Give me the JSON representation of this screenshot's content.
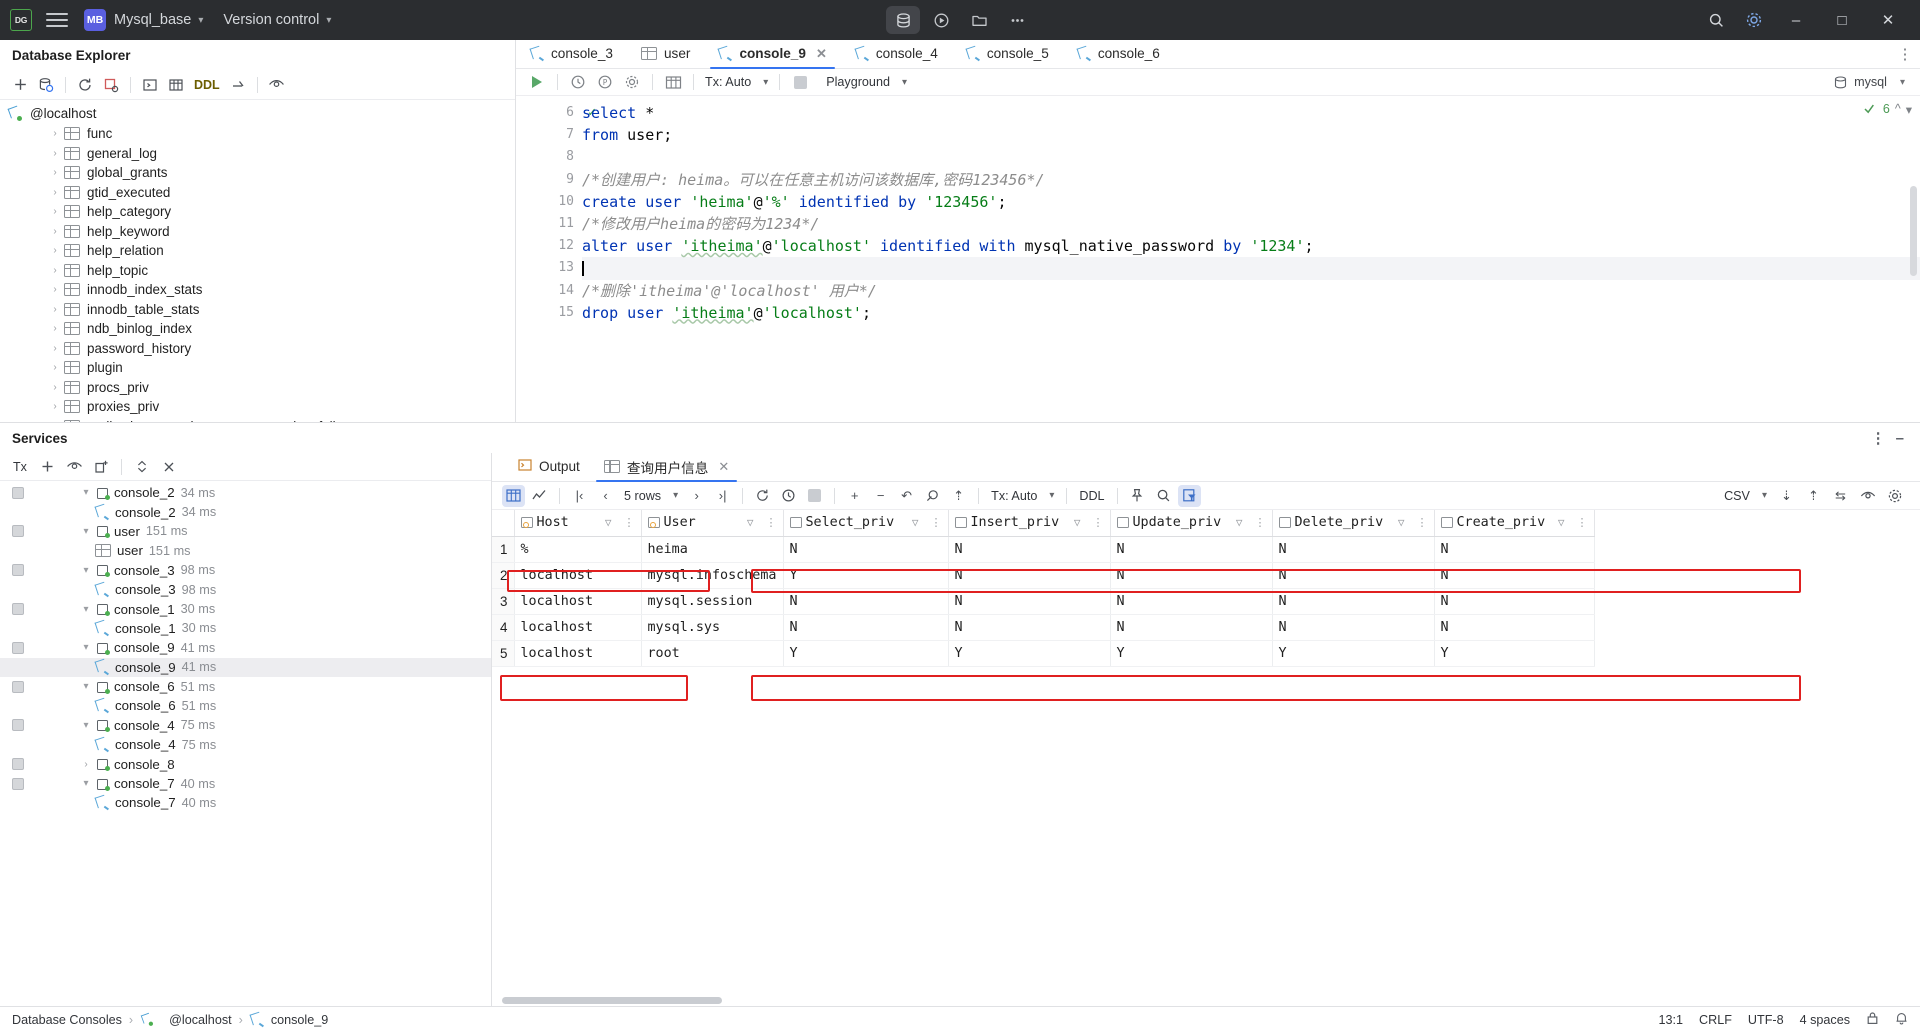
{
  "titlebar": {
    "logo": "DG",
    "project_badge": "MB",
    "project_name": "Mysql_base",
    "version_control": "Version control",
    "center_buttons": [
      "database-icon",
      "run-config-icon",
      "folder-icon",
      "more-icon"
    ],
    "right_buttons": [
      "search-icon",
      "settings-icon"
    ],
    "window_buttons": [
      "minimize",
      "maximize",
      "close"
    ]
  },
  "explorer": {
    "title": "Database Explorer",
    "tools": [
      "add-icon",
      "database-icon",
      "refresh-icon",
      "stop-refresh-icon",
      "console-icon",
      "table-icon",
      "DDL",
      "jump-icon",
      "eye-icon"
    ],
    "ddl_label": "DDL",
    "host": "@localhost",
    "tables": [
      "func",
      "general_log",
      "global_grants",
      "gtid_executed",
      "help_category",
      "help_keyword",
      "help_relation",
      "help_topic",
      "innodb_index_stats",
      "innodb_table_stats",
      "ndb_binlog_index",
      "password_history",
      "plugin",
      "procs_priv",
      "proxies_priv",
      "replication_asynchronous_connection_failover"
    ]
  },
  "editor": {
    "tabs": [
      {
        "label": "console_3",
        "icon": "console-icon",
        "active": false,
        "closable": false
      },
      {
        "label": "user",
        "icon": "table-icon",
        "active": false,
        "closable": false
      },
      {
        "label": "console_9",
        "icon": "console-icon",
        "active": true,
        "closable": true
      },
      {
        "label": "console_4",
        "icon": "console-icon",
        "active": false,
        "closable": false
      },
      {
        "label": "console_5",
        "icon": "console-icon",
        "active": false,
        "closable": false
      },
      {
        "label": "console_6",
        "icon": "console-icon",
        "active": false,
        "closable": false
      }
    ],
    "toolbar": {
      "run": "run-icon",
      "history": "history-icon",
      "profile": "profiler-icon",
      "settings": "gear-icon",
      "table": "table-icon",
      "tx_label": "Tx: Auto",
      "stop": "stop-icon",
      "schema_label": "Playground",
      "datasource_label": "mysql"
    },
    "inspection_count": "6",
    "code_lines": [
      {
        "num": "6",
        "check": true,
        "tokens": [
          {
            "t": "select ",
            "c": "kw"
          },
          {
            "t": "*",
            "c": "plain"
          }
        ]
      },
      {
        "num": "7",
        "check": false,
        "tokens": [
          {
            "t": "from ",
            "c": "kw"
          },
          {
            "t": "user;",
            "c": "plain"
          }
        ]
      },
      {
        "num": "8",
        "check": false,
        "tokens": []
      },
      {
        "num": "9",
        "check": false,
        "tokens": [
          {
            "t": "/*创建用户: heima。可以在任意主机访问该数据库,密码123456*/",
            "c": "cmt"
          }
        ]
      },
      {
        "num": "10",
        "check": false,
        "tokens": [
          {
            "t": "create user ",
            "c": "kw"
          },
          {
            "t": "'heima'",
            "c": "str"
          },
          {
            "t": "@",
            "c": "plain"
          },
          {
            "t": "'%'",
            "c": "str"
          },
          {
            "t": " ",
            "c": "plain"
          },
          {
            "t": "identified by ",
            "c": "kw"
          },
          {
            "t": "'123456'",
            "c": "str"
          },
          {
            "t": ";",
            "c": "plain"
          }
        ]
      },
      {
        "num": "11",
        "check": false,
        "tokens": [
          {
            "t": "/*修改用户heima的密码为1234*/",
            "c": "cmt"
          }
        ]
      },
      {
        "num": "12",
        "check": false,
        "tokens": [
          {
            "t": "alter user ",
            "c": "kw"
          },
          {
            "t": "'itheima'",
            "c": "str squig"
          },
          {
            "t": "@",
            "c": "plain"
          },
          {
            "t": "'localhost'",
            "c": "str"
          },
          {
            "t": " ",
            "c": "plain"
          },
          {
            "t": "identified with ",
            "c": "kw"
          },
          {
            "t": "mysql_native_password ",
            "c": "plain"
          },
          {
            "t": "by ",
            "c": "kw"
          },
          {
            "t": "'1234'",
            "c": "str"
          },
          {
            "t": ";",
            "c": "plain"
          }
        ]
      },
      {
        "num": "13",
        "check": false,
        "caret": true,
        "tokens": []
      },
      {
        "num": "14",
        "check": false,
        "tokens": [
          {
            "t": "/*删除",
            "c": "cmt"
          },
          {
            "t": "'itheima'@'localhost'",
            "c": "cmt"
          },
          {
            "t": " 用户*/",
            "c": "cmt"
          }
        ]
      },
      {
        "num": "15",
        "check": false,
        "tokens": [
          {
            "t": "drop user ",
            "c": "kw"
          },
          {
            "t": "'itheima'",
            "c": "str squig"
          },
          {
            "t": "@",
            "c": "plain"
          },
          {
            "t": "'localhost'",
            "c": "str"
          },
          {
            "t": ";",
            "c": "plain"
          }
        ]
      }
    ]
  },
  "services": {
    "title": "Services",
    "tools": [
      "Tx",
      "add-icon",
      "eye-icon",
      "new-tab-icon",
      "expand-icon",
      "close-icon"
    ],
    "tx_label": "Tx",
    "tree": [
      {
        "label": "console_2",
        "time": "34 ms",
        "level": 0,
        "icon": "session-icon",
        "expanded": true,
        "selected": false
      },
      {
        "label": "console_2",
        "time": "34 ms",
        "level": 1,
        "icon": "console-icon",
        "expanded": false,
        "selected": false
      },
      {
        "label": "user",
        "time": "151 ms",
        "level": 0,
        "icon": "session-icon",
        "expanded": true,
        "selected": false
      },
      {
        "label": "user",
        "time": "151 ms",
        "level": 1,
        "icon": "table-icon",
        "expanded": false,
        "selected": false
      },
      {
        "label": "console_3",
        "time": "98 ms",
        "level": 0,
        "icon": "session-icon",
        "expanded": true,
        "selected": false
      },
      {
        "label": "console_3",
        "time": "98 ms",
        "level": 1,
        "icon": "console-icon",
        "expanded": false,
        "selected": false
      },
      {
        "label": "console_1",
        "time": "30 ms",
        "level": 0,
        "icon": "session-icon",
        "expanded": true,
        "selected": false
      },
      {
        "label": "console_1",
        "time": "30 ms",
        "level": 1,
        "icon": "console-icon",
        "expanded": false,
        "selected": false
      },
      {
        "label": "console_9",
        "time": "41 ms",
        "level": 0,
        "icon": "session-icon",
        "expanded": true,
        "selected": false
      },
      {
        "label": "console_9",
        "time": "41 ms",
        "level": 1,
        "icon": "console-icon",
        "expanded": false,
        "selected": true
      },
      {
        "label": "console_6",
        "time": "51 ms",
        "level": 0,
        "icon": "session-icon",
        "expanded": true,
        "selected": false
      },
      {
        "label": "console_6",
        "time": "51 ms",
        "level": 1,
        "icon": "console-icon",
        "expanded": false,
        "selected": false
      },
      {
        "label": "console_4",
        "time": "75 ms",
        "level": 0,
        "icon": "session-icon",
        "expanded": true,
        "selected": false
      },
      {
        "label": "console_4",
        "time": "75 ms",
        "level": 1,
        "icon": "console-icon",
        "expanded": false,
        "selected": false
      },
      {
        "label": "console_8",
        "time": "",
        "level": 0,
        "icon": "session-icon",
        "expanded": false,
        "selected": false
      },
      {
        "label": "console_7",
        "time": "40 ms",
        "level": 0,
        "icon": "session-icon",
        "expanded": true,
        "selected": false
      },
      {
        "label": "console_7",
        "time": "40 ms",
        "level": 1,
        "icon": "console-icon",
        "expanded": false,
        "selected": false
      }
    ]
  },
  "results": {
    "tabs": [
      {
        "label": "Output",
        "icon": "output-icon",
        "active": false,
        "closable": false
      },
      {
        "label": "查询用户信息",
        "icon": "table-icon",
        "active": true,
        "closable": true
      }
    ],
    "toolbar": {
      "grid_view": "grid-icon",
      "chart_view": "chart-icon",
      "first": "first-page-icon",
      "prev": "prev-page-icon",
      "rows_label": "5 rows",
      "next": "next-page-icon",
      "last": "last-page-icon",
      "refresh": "refresh-icon",
      "history": "history-icon",
      "stop": "stop-icon",
      "add_row": "add-row-icon",
      "remove_row": "remove-row-icon",
      "revert": "revert-icon",
      "submit": "submit-icon",
      "upload": "upload-icon",
      "tx_label": "Tx: Auto",
      "ddl_label": "DDL",
      "pin": "pin-icon",
      "search": "search-icon",
      "filter": "filter-icon",
      "export_label": "CSV",
      "download": "download-icon",
      "import": "import-icon",
      "compare": "compare-icon",
      "preview": "eye-icon",
      "settings": "gear-icon"
    },
    "columns": [
      "Host",
      "User",
      "Select_priv",
      "Insert_priv",
      "Update_priv",
      "Delete_priv",
      "Create_priv"
    ],
    "rows": [
      {
        "n": "1",
        "Host": "%",
        "User": "heima",
        "Select_priv": "N",
        "Insert_priv": "N",
        "Update_priv": "N",
        "Delete_priv": "N",
        "Create_priv": "N"
      },
      {
        "n": "2",
        "Host": "localhost",
        "User": "mysql.infoschema",
        "Select_priv": "Y",
        "Insert_priv": "N",
        "Update_priv": "N",
        "Delete_priv": "N",
        "Create_priv": "N"
      },
      {
        "n": "3",
        "Host": "localhost",
        "User": "mysql.session",
        "Select_priv": "N",
        "Insert_priv": "N",
        "Update_priv": "N",
        "Delete_priv": "N",
        "Create_priv": "N"
      },
      {
        "n": "4",
        "Host": "localhost",
        "User": "mysql.sys",
        "Select_priv": "N",
        "Insert_priv": "N",
        "Update_priv": "N",
        "Delete_priv": "N",
        "Create_priv": "N"
      },
      {
        "n": "5",
        "Host": "localhost",
        "User": "root",
        "Select_priv": "Y",
        "Insert_priv": "Y",
        "Update_priv": "Y",
        "Delete_priv": "Y",
        "Create_priv": "Y"
      }
    ],
    "highlight_color": "#e02020"
  },
  "status": {
    "left": [
      "Database Consoles",
      "@localhost",
      "console_9"
    ],
    "caret_position": "13:1",
    "line_separator": "CRLF",
    "encoding": "UTF-8",
    "indent": "4 spaces",
    "lock_icon": "lock-icon",
    "notify_icon": "bell-icon"
  }
}
